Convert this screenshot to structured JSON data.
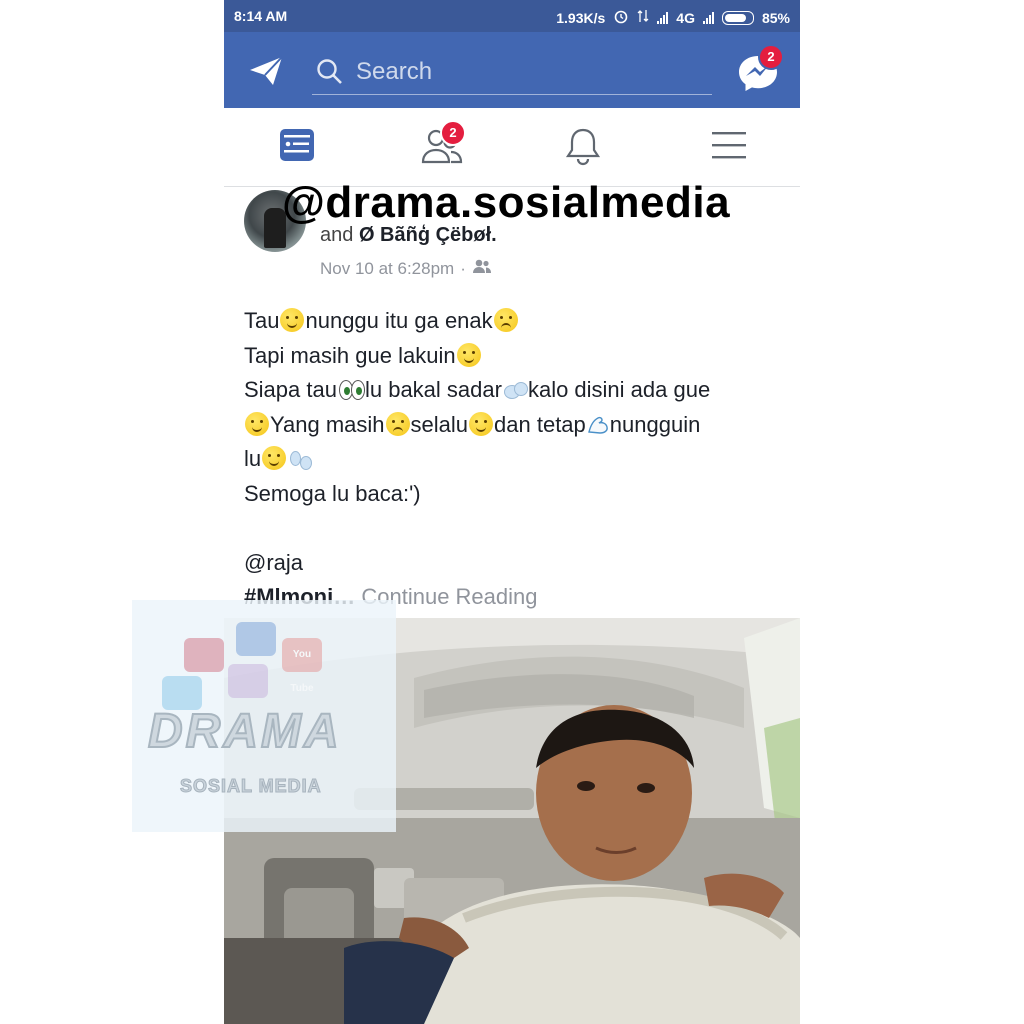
{
  "status_bar": {
    "time": "8:14 AM",
    "net_speed": "1.93K/s",
    "network": "4G",
    "battery": "85%",
    "battery_level": 0.85
  },
  "top_bar": {
    "search_placeholder": "Search",
    "messenger_badge": "2",
    "colors": {
      "bar": "#4267b2",
      "status": "#3b5998",
      "badge": "#e41e3f"
    }
  },
  "tabs": {
    "friends_badge": "2",
    "icons": [
      "news-feed-icon",
      "friend-requests-icon",
      "notifications-icon",
      "menu-icon"
    ]
  },
  "watermark_handle": "@drama.sosialmedia",
  "post": {
    "author_prefix": "and",
    "author_name": "Ø Bãñģ Çëbøł.",
    "timestamp": "Nov 10 at 6:28pm",
    "separator": "·",
    "lines": [
      [
        "Tau",
        "nunggu itu ga enak"
      ],
      [
        "Tapi masih gue lakuin"
      ],
      [
        "Siapa tau",
        "lu bakal sadar",
        "kalo disini ada gue"
      ],
      [
        "Yang masih",
        "selalu",
        "dan tetap",
        "nungguin"
      ],
      [
        "lu"
      ],
      [
        "Semoga lu baca:')"
      ],
      [
        "@raja"
      ]
    ],
    "hashtag": "#Mlmoni…",
    "continue": "Continue Reading"
  },
  "watermark_logo": {
    "title": "DRAMA",
    "subtitle": "SOSIAL MEDIA",
    "tile_label": "You Tube"
  }
}
